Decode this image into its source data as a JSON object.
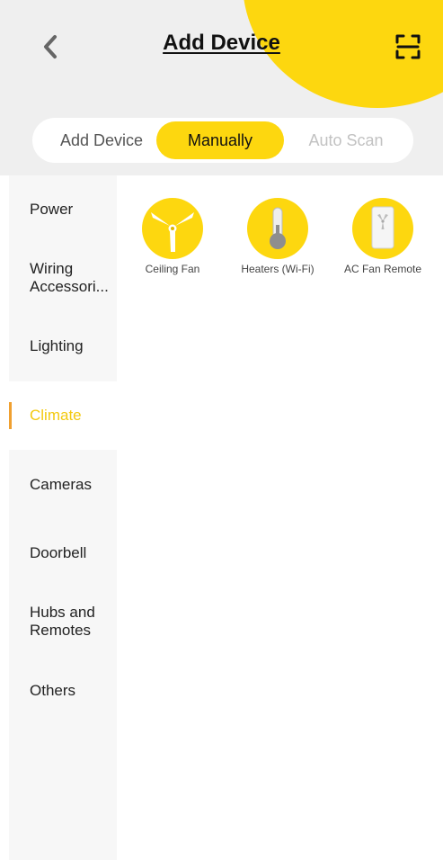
{
  "header": {
    "title": "Add Device",
    "back_icon": "chevron-left-icon",
    "scan_icon": "qr-scan-icon",
    "accent_color": "#fdd70f"
  },
  "tabs": {
    "add_device": "Add Device",
    "manually": "Manually",
    "auto_scan": "Auto Scan",
    "selected": "Manually"
  },
  "sidebar": {
    "items": [
      {
        "label": "Power"
      },
      {
        "label": "Wiring Accessori..."
      },
      {
        "label": "Lighting"
      },
      {
        "label": "Climate"
      },
      {
        "label": "Cameras"
      },
      {
        "label": "Doorbell"
      },
      {
        "label": "Hubs and Remotes"
      },
      {
        "label": "Others"
      }
    ],
    "active": "Climate",
    "active_color": "#f3c90f"
  },
  "devices": [
    {
      "label": "Ceiling Fan",
      "icon": "ceiling-fan-icon"
    },
    {
      "label": "Heaters (Wi-Fi)",
      "icon": "thermometer-icon"
    },
    {
      "label": "AC Fan Remote",
      "icon": "remote-icon"
    }
  ]
}
